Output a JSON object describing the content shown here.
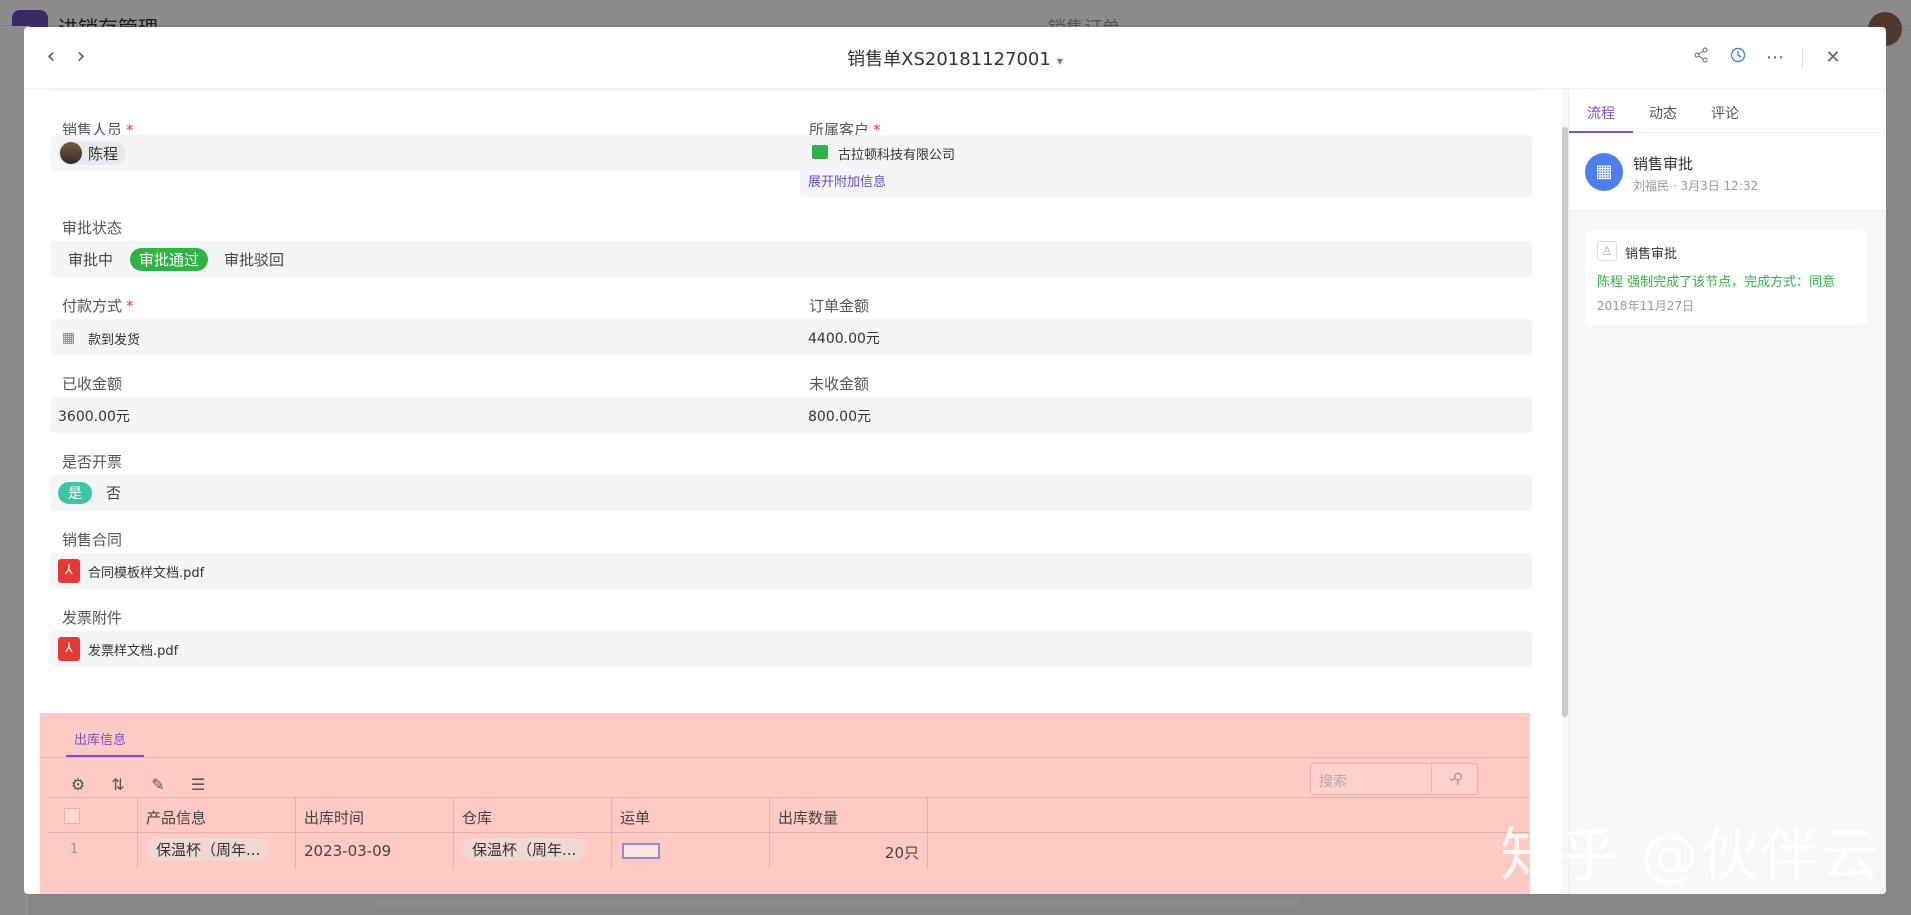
{
  "background": {
    "app_title": "进销存管理",
    "center_title": "销售订单"
  },
  "modal": {
    "title": "销售单XS20181127001",
    "fields": {
      "salesperson": {
        "label": "销售人员",
        "value": "陈程"
      },
      "customer": {
        "label": "所属客户",
        "value": "古拉顿科技有限公司",
        "expand": "展开附加信息"
      },
      "approval_status": {
        "label": "审批状态",
        "options": [
          "审批中",
          "审批通过",
          "审批驳回"
        ],
        "selected": "审批通过"
      },
      "payment_method": {
        "label": "付款方式",
        "value": "款到发货"
      },
      "order_amount": {
        "label": "订单金额",
        "value": "4400.00元"
      },
      "received_amount": {
        "label": "已收金额",
        "value": "3600.00元"
      },
      "unreceived_amount": {
        "label": "未收金额",
        "value": "800.00元"
      },
      "invoice": {
        "label": "是否开票",
        "options": [
          "是",
          "否"
        ],
        "selected": "是"
      },
      "contract": {
        "label": "销售合同",
        "file": "合同模板样文档.pdf"
      },
      "invoice_attachment": {
        "label": "发票附件",
        "file": "发票样文档.pdf"
      }
    },
    "outbound": {
      "tab": "出库信息",
      "search_placeholder": "搜索",
      "columns": [
        "产品信息",
        "出库时间",
        "仓库",
        "运单",
        "出库数量"
      ],
      "rows": [
        {
          "index": "1",
          "product": "保温杯（周年...",
          "time": "2023-03-09",
          "warehouse": "保温杯（周年...",
          "qty": "20只"
        }
      ]
    }
  },
  "right_panel": {
    "tabs": [
      "流程",
      "动态",
      "评论"
    ],
    "active_tab": "流程",
    "workflow_title": "销售审批",
    "workflow_meta": "刘福民 · 3月3日 12:32",
    "card": {
      "node": "销售审批",
      "message": "陈程 强制完成了该节点，完成方式：同意",
      "date": "2018年11月27日"
    }
  },
  "watermark": "知乎 @伙伴云",
  "colors": {
    "accent": "#7b52c9",
    "success": "#2fb344",
    "danger": "#e53935",
    "highlight": "#ffc9c4"
  }
}
